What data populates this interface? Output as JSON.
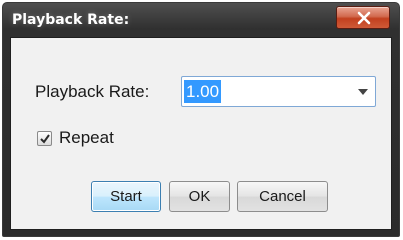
{
  "window": {
    "title": "Playback Rate:",
    "close_label": "x"
  },
  "form": {
    "rate_label": "Playback Rate:",
    "rate_value": "1.00",
    "repeat_label": "Repeat",
    "repeat_checked": true
  },
  "buttons": {
    "start": "Start",
    "ok": "OK",
    "cancel": "Cancel"
  },
  "colors": {
    "title_bar": "#303030",
    "close_button": "#c2401f",
    "selection": "#3399ff",
    "dialog_background": "#f1f1f1"
  }
}
